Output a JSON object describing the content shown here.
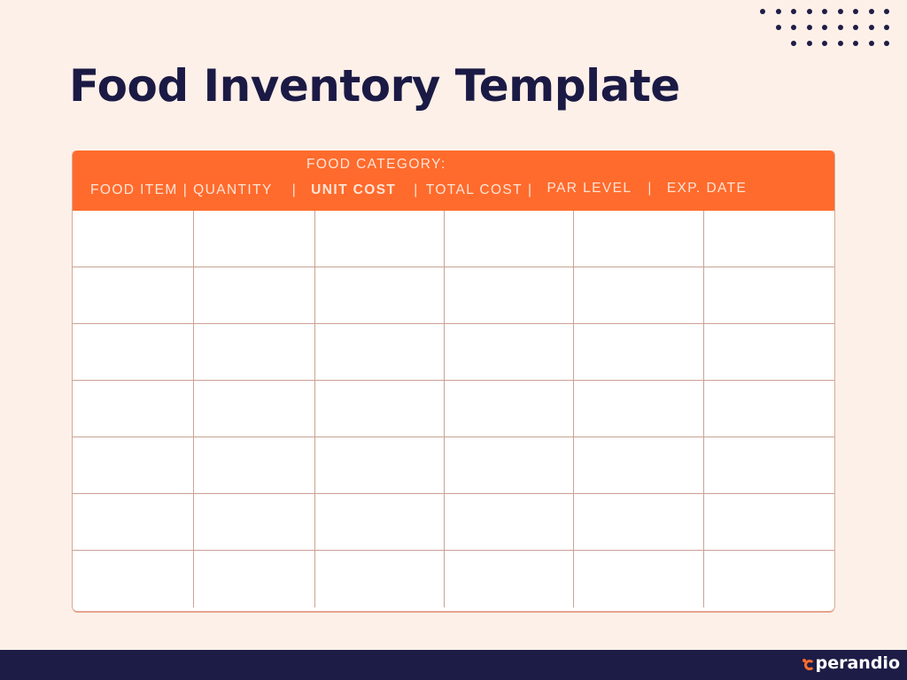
{
  "title": "Food Inventory Template",
  "decoration": {
    "dot_rows": [
      9,
      8,
      7
    ],
    "dot_color": "#1f1d45"
  },
  "table": {
    "category_label": "FOOD CATEGORY:",
    "columns": [
      "FOOD ITEM",
      "QUANTITY",
      "UNIT COST",
      "TOTAL COST",
      "PAR LEVEL",
      "EXP. DATE"
    ],
    "separator": "|",
    "row_count": 7,
    "header_color": "#ff6b2c",
    "rows": [
      [
        "",
        "",
        "",
        "",
        "",
        ""
      ],
      [
        "",
        "",
        "",
        "",
        "",
        ""
      ],
      [
        "",
        "",
        "",
        "",
        "",
        ""
      ],
      [
        "",
        "",
        "",
        "",
        "",
        ""
      ],
      [
        "",
        "",
        "",
        "",
        "",
        ""
      ],
      [
        "",
        "",
        "",
        "",
        "",
        ""
      ],
      [
        "",
        "",
        "",
        "",
        "",
        ""
      ]
    ]
  },
  "footer": {
    "brand": "perandio",
    "brand_mark": "o"
  }
}
